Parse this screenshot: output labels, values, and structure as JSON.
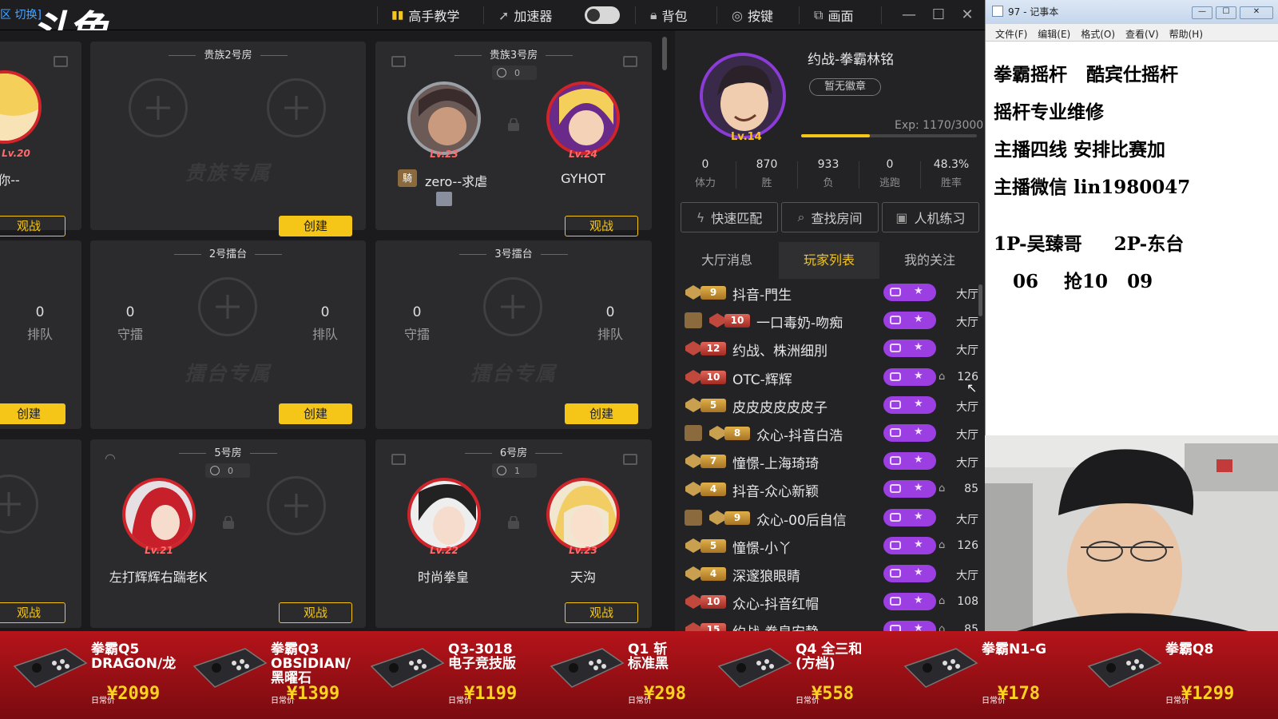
{
  "topbar": {
    "logo": "斗鱼",
    "top_left_link": "区 切换]",
    "items": {
      "expert": "高手教学",
      "accelerator": "加速器",
      "bag": "背包",
      "keys": "按键",
      "display": "画面"
    }
  },
  "rooms": {
    "noble2": {
      "title": "贵族2号房",
      "watermark": "贵族专属",
      "create": "创建"
    },
    "noble3": {
      "title": "贵族3号房",
      "seat_count": "0",
      "p1_name": "zero--求虐",
      "p1_lv": "Lv.23",
      "p2_name": "GYHOT",
      "p2_lv": "Lv.24",
      "watch": "观战"
    },
    "left1": {
      "lv": "Lv.20",
      "name": "服你--",
      "watch": "观战"
    },
    "arena2": {
      "title": "2号擂台",
      "guard_n": "0",
      "guard_l": "守擂",
      "queue_n": "0",
      "queue_l": "排队",
      "watermark": "擂台专属",
      "create": "创建"
    },
    "arena3": {
      "title": "3号擂台",
      "guard_n": "0",
      "guard_l": "守擂",
      "queue_n": "0",
      "queue_l": "排队",
      "watermark": "擂台专属",
      "create": "创建"
    },
    "left2": {
      "queue_n": "0",
      "queue_l": "排队",
      "create": "创建"
    },
    "room5": {
      "title": "5号房",
      "seat_count": "0",
      "p1_name": "左打辉辉右踹老K",
      "p1_lv": "Lv.21",
      "watch": "观战"
    },
    "room6": {
      "title": "6号房",
      "seat_count": "1",
      "p1_name": "时尚拳皇",
      "p1_lv": "Lv.22",
      "p2_name": "天沟",
      "p2_lv": "Lv.23",
      "watch": "观战"
    },
    "left3": {
      "watch": "观战"
    }
  },
  "profile": {
    "name": "约战-拳霸林铭",
    "badge": "暂无徽章",
    "level": "Lv.14",
    "exp": "Exp: 1170/3000",
    "exp_fraction": 0.39,
    "stats": [
      {
        "n": "0",
        "l": "体力"
      },
      {
        "n": "870",
        "l": "胜"
      },
      {
        "n": "933",
        "l": "负"
      },
      {
        "n": "0",
        "l": "逃跑"
      },
      {
        "n": "48.3%",
        "l": "胜率"
      }
    ],
    "actions": {
      "quick": "快速匹配",
      "find": "查找房间",
      "bot": "人机练习"
    },
    "tabs": {
      "hall": "大厅消息",
      "players": "玩家列表",
      "follow": "我的关注"
    }
  },
  "players": [
    {
      "lv": "9",
      "tier": "gold",
      "name": "抖音-門生",
      "loc": "大厅",
      "noble": false
    },
    {
      "lv": "10",
      "tier": "red",
      "name": "一口毒奶-吻痴",
      "loc": "大厅",
      "noble": true
    },
    {
      "lv": "12",
      "tier": "red",
      "name": "约战、株洲细刖",
      "loc": "大厅",
      "noble": false
    },
    {
      "lv": "10",
      "tier": "red",
      "name": "OTC-辉辉",
      "loc": "126",
      "noble": false,
      "room": true
    },
    {
      "lv": "5",
      "tier": "gold",
      "name": "皮皮皮皮皮皮子",
      "loc": "大厅",
      "noble": false
    },
    {
      "lv": "8",
      "tier": "gold",
      "name": "众心-抖音白浩",
      "loc": "大厅",
      "noble": true
    },
    {
      "lv": "7",
      "tier": "gold",
      "name": "憧憬-上海琦琦",
      "loc": "大厅",
      "noble": false
    },
    {
      "lv": "4",
      "tier": "gold",
      "name": "抖音-众心新颖",
      "loc": "85",
      "noble": false,
      "room": true
    },
    {
      "lv": "9",
      "tier": "gold",
      "name": "众心-00后自信",
      "loc": "大厅",
      "noble": true
    },
    {
      "lv": "5",
      "tier": "gold",
      "name": "憧憬-小丫",
      "loc": "126",
      "noble": false,
      "room": true
    },
    {
      "lv": "4",
      "tier": "gold",
      "name": "深邃狼眼睛",
      "loc": "大厅",
      "noble": false
    },
    {
      "lv": "10",
      "tier": "red",
      "name": "众心-抖音红帽",
      "loc": "108",
      "noble": false,
      "room": true
    },
    {
      "lv": "15",
      "tier": "red",
      "name": "约战-拳皇安静",
      "loc": "85",
      "noble": false,
      "room": true
    }
  ],
  "notepad": {
    "title": "97 - 记事本",
    "menu": [
      "文件(F)",
      "编辑(E)",
      "格式(O)",
      "查看(V)",
      "帮助(H)"
    ],
    "lines": [
      "拳霸摇杆   酷宾仕摇杆",
      "摇杆专业维修",
      "主播四线 安排比赛加",
      "主播微信 lin1980047",
      "",
      "1P-吴臻哥     2P-东台",
      "   06    抢10   09"
    ]
  },
  "banner": {
    "products": [
      {
        "name": "拳霸Q5\nDRAGON/龙",
        "label": "日常价",
        "price": "¥2099"
      },
      {
        "name": "拳霸Q3\nOBSIDIAN/\n黑曜石",
        "label": "日常价",
        "price": "¥1399"
      },
      {
        "name": "Q3-3018\n电子竞技版",
        "label": "日常价",
        "price": "¥1199"
      },
      {
        "name": "Q1 斩\n标准黑",
        "label": "日常价",
        "price": "¥298"
      },
      {
        "name": "Q4 全三和\n(方档)",
        "label": "日常价",
        "price": "¥558"
      },
      {
        "name": "拳霸N1-G",
        "label": "日常价",
        "price": "¥178"
      },
      {
        "name": "拳霸Q8",
        "label": "日常价",
        "price": "¥1299"
      }
    ]
  },
  "colors": {
    "accent": "#f5c518",
    "danger": "#d0242a",
    "purple": "#9b3ee2",
    "banner": "#b5141a"
  }
}
